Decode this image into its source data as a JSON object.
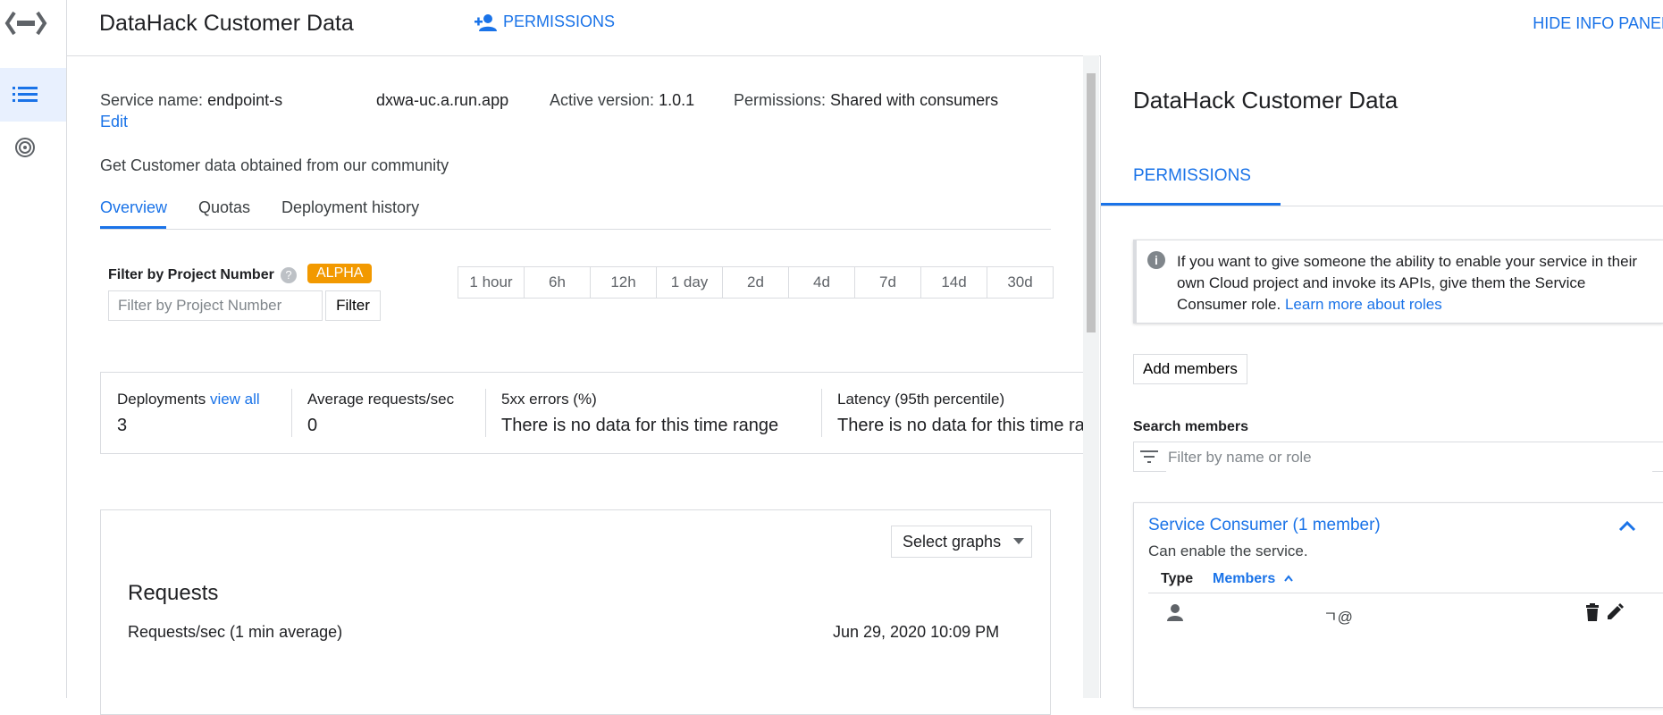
{
  "header": {
    "title": "DataHack Customer Data",
    "permissions_label": "PERMISSIONS",
    "hide_panel_label": "HIDE INFO PANEL"
  },
  "service": {
    "name_label": "Service name:",
    "name_value_start": "endpoint-s",
    "name_value_end": "dxwa-uc.a.run.app",
    "version_label": "Active version:",
    "version_value": "1.0.1",
    "permissions_label": "Permissions:",
    "permissions_value": "Shared with consumers",
    "edit_label": "Edit",
    "description": "Get Customer data obtained from our community"
  },
  "tabs": [
    "Overview",
    "Quotas",
    "Deployment history"
  ],
  "filter": {
    "label": "Filter by Project Number",
    "badge": "ALPHA",
    "placeholder": "Filter by Project Number",
    "button": "Filter"
  },
  "time_ranges": [
    "1 hour",
    "6h",
    "12h",
    "1 day",
    "2d",
    "4d",
    "7d",
    "14d",
    "30d"
  ],
  "stats": {
    "deployments_label": "Deployments",
    "view_all": "view all",
    "deployments_value": "3",
    "avg_label": "Average requests/sec",
    "avg_value": "0",
    "errors_label": "5xx errors (%)",
    "errors_value": "There is no data for this time range",
    "latency_label": "Latency (95th percentile)",
    "latency_value": "There is no data for this time ran"
  },
  "graphs": {
    "select_label": "Select graphs",
    "title": "Requests",
    "subtitle": "Requests/sec (1 min average)",
    "date": "Jun 29, 2020 10:09 PM"
  },
  "panel": {
    "title": "DataHack Customer Data",
    "tab": "PERMISSIONS",
    "info_text": "If you want to give someone the ability to enable your service in their own Cloud project and invoke its APIs, give them the Service Consumer role.",
    "info_link": "Learn more about roles",
    "add_members": "Add members",
    "search_label": "Search members",
    "search_placeholder": "Filter by name or role",
    "role_title": "Service Consumer (1 member)",
    "role_desc": "Can enable the service.",
    "col_type": "Type",
    "col_members": "Members",
    "member_email": "ㄱ@"
  },
  "colors": {
    "accent": "#1a73e8",
    "alpha_badge": "#f29900",
    "active_rail": "#e8f0fe"
  },
  "icons": [
    "endpoints-logo-icon",
    "list-icon",
    "target-icon",
    "person-add-icon",
    "help-icon",
    "info-icon",
    "filter-icon",
    "chevron-up-icon",
    "arrow-up-icon",
    "person-icon",
    "delete-icon",
    "edit-icon",
    "dropdown-arrow-icon"
  ]
}
